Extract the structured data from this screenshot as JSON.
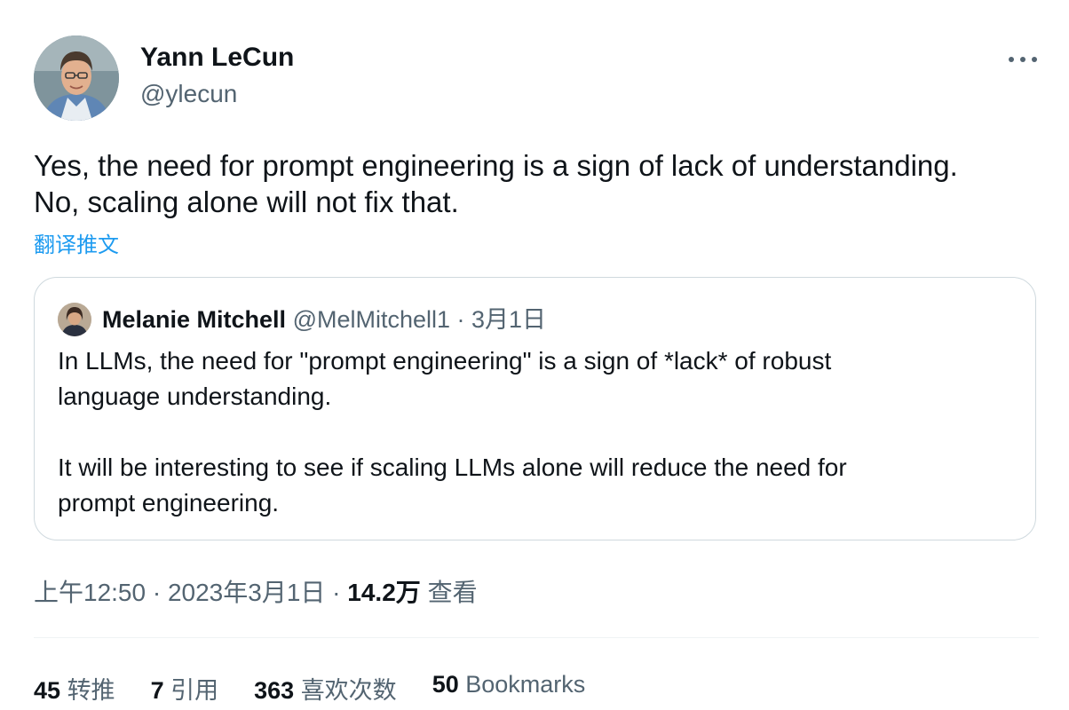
{
  "author": {
    "name": "Yann LeCun",
    "handle": "@ylecun"
  },
  "tweet": {
    "lines": [
      "Yes, the need for prompt engineering is a sign of lack of understanding.",
      "No, scaling alone will not fix that."
    ],
    "translate_label": "翻译推文"
  },
  "quote": {
    "name": "Melanie Mitchell",
    "meta": "@MelMitchell1 · 3月1日",
    "lines": [
      "In LLMs, the need for \"prompt engineering\" is a sign of *lack* of robust",
      "language understanding.",
      "",
      "It will be interesting to see if scaling LLMs alone will reduce the need for",
      "prompt engineering."
    ]
  },
  "meta": {
    "time_date": "上午12:50 · 2023年3月1日 · ",
    "views_count": "14.2万",
    "views_label": "查看"
  },
  "stats": {
    "retweets": {
      "count": "45",
      "label": "转推"
    },
    "quotes": {
      "count": "7",
      "label": "引用"
    },
    "likes": {
      "count": "363",
      "label": "喜欢次数"
    },
    "bookmarks": {
      "count": "50",
      "label": "Bookmarks"
    }
  },
  "icons": {
    "more": "more-dots-icon"
  }
}
